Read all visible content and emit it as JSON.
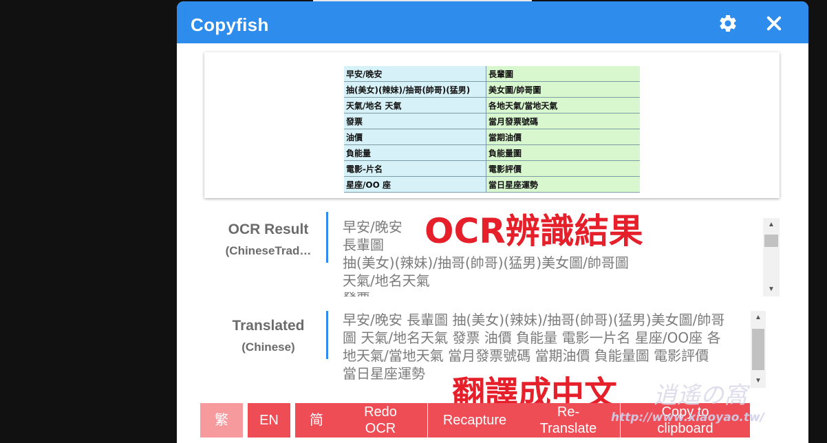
{
  "window": {
    "title": "Copyfish"
  },
  "preview_table": {
    "rows": [
      [
        "早安/晚安",
        "長輩圖"
      ],
      [
        "抽(美女)(辣妹)/抽哥(帥哥)(猛男)",
        "美女圖/帥哥圖"
      ],
      [
        "天氣/地名 天氣",
        "各地天氣/當地天氣"
      ],
      [
        "發票",
        "當月發票號碼"
      ],
      [
        "油價",
        "當期油價"
      ],
      [
        "負能量",
        "負能量圖"
      ],
      [
        "電影-片名",
        "電影評價"
      ],
      [
        "星座/OO 座",
        "當日星座運勢"
      ]
    ]
  },
  "ocr": {
    "label": "OCR Result",
    "language": "(ChineseTrad…",
    "lines": [
      "早安/晚安",
      "長輩圖",
      "抽(美女)(辣妹)/抽哥(帥哥)(猛男)美女圖/帥哥圖",
      "天氣/地名天氣",
      "發票"
    ]
  },
  "translated": {
    "label": "Translated",
    "language": "(Chinese)",
    "lines": [
      "早安/晚安 長輩圖 抽(美女)(辣妹)/抽哥(帥哥)(猛男)美女圖/帥哥",
      "圖 天氣/地名天氣 發票 油價 負能量 電影一片名 星座/OO座 各",
      "地天氣/當地天氣 當月發票號碼 當期油價 負能量圖 電影評價",
      "當日星座運勢"
    ]
  },
  "annotations": {
    "ocr_note": "OCR辨識結果",
    "translate_note": "翻譯成中文"
  },
  "buttons": {
    "trad": "繁",
    "en": "EN",
    "simp": "简",
    "redo_ocr_1": "Redo",
    "redo_ocr_2": "OCR",
    "recapture": "Recapture",
    "retranslate_1": "Re-",
    "retranslate_2": "Translate",
    "copy_1": "Copy to",
    "copy_2": "clipboard"
  },
  "watermark": {
    "title": "逍遙の窩",
    "url": "http://www.xiaoyao.tw/"
  },
  "colors": {
    "titlebar": "#2d8cec",
    "button": "#ef4d55",
    "button_disabled": "#f79a9e",
    "annotation": "#e5202a"
  },
  "icons": {
    "settings": "gear-icon",
    "close": "close-icon"
  }
}
